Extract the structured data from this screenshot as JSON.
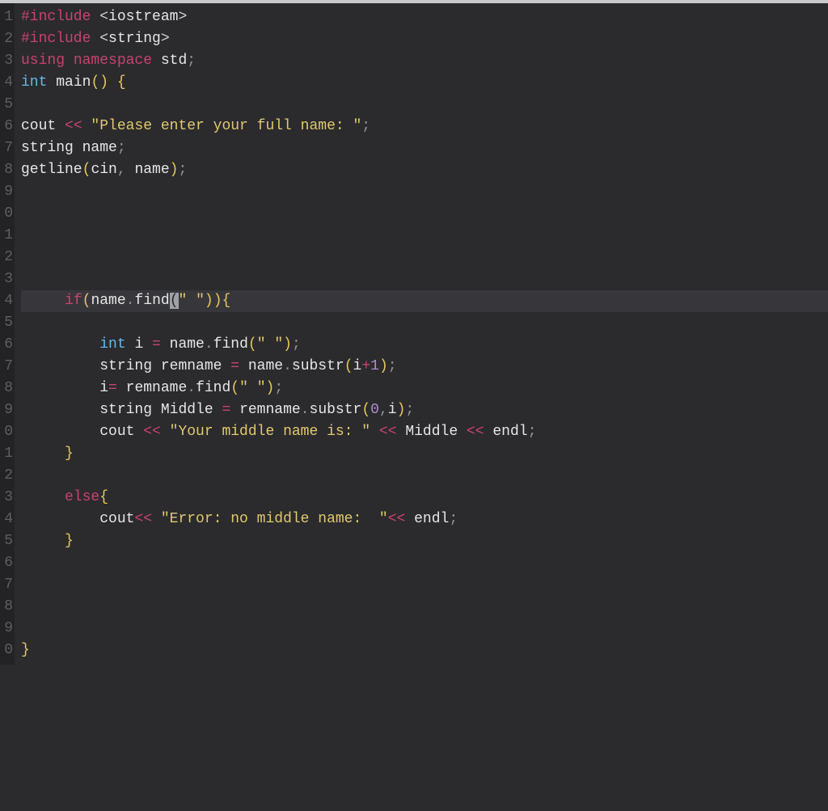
{
  "gutter": [
    "1",
    "2",
    "3",
    "4",
    "5",
    "6",
    "7",
    "8",
    "9",
    "0",
    "1",
    "2",
    "3",
    "4",
    "5",
    "6",
    "7",
    "8",
    "9",
    "0",
    "1",
    "2",
    "3",
    "4",
    "5",
    "6",
    "7",
    "8",
    "9",
    "0"
  ],
  "code": {
    "l1": {
      "pre": "#include ",
      "lt": "<",
      "lib": "iostream",
      "gt": ">"
    },
    "l2": {
      "pre": "#include ",
      "lt": "<",
      "lib": "string",
      "gt": ">"
    },
    "l3": {
      "using": "using ",
      "ns": "namespace ",
      "std": "std",
      "semi": ";"
    },
    "l4": {
      "type": "int ",
      "main": "main",
      "lp": "(",
      "rp": ")",
      " ": " ",
      "lb": "{"
    },
    "l6": {
      "cout": "cout ",
      "op1": "<< ",
      "str": "\"Please enter your full name: \"",
      "semi": ";"
    },
    "l7": {
      "type": "string ",
      "id": "name",
      "semi": ";"
    },
    "l8": {
      "fn": "getline",
      "lp": "(",
      "cin": "cin",
      "comma": ", ",
      "name": "name",
      "rp": ")",
      "semi": ";"
    },
    "l14": {
      "indent": "     ",
      "if": "if",
      "lp": "(",
      "name": "name",
      "dot": ".",
      "find": "find",
      "lp2": "(",
      "cursorstr": "\" \"",
      "rp2": ")",
      "rp": ")",
      "lb": "{"
    },
    "l16": {
      "indent": "         ",
      "type": "int ",
      "i": "i ",
      "eq": "= ",
      "name": "name",
      "dot": ".",
      "find": "find",
      "lp": "(",
      "str": "\" \"",
      "rp": ")",
      "semi": ";"
    },
    "l17": {
      "indent": "         ",
      "type": "string ",
      "rem": "remname ",
      "eq": "= ",
      "name": "name",
      "dot": ".",
      "sub": "substr",
      "lp": "(",
      "i": "i",
      "plus": "+",
      "one": "1",
      "rp": ")",
      "semi": ";"
    },
    "l18": {
      "indent": "         ",
      "i": "i",
      "eq": "= ",
      "rem": "remname",
      "dot": ".",
      "find": "find",
      "lp": "(",
      "str": "\" \"",
      "rp": ")",
      "semi": ";"
    },
    "l19": {
      "indent": "         ",
      "type": "string ",
      "mid": "Middle ",
      "eq": "= ",
      "rem": "remname",
      "dot": ".",
      "sub": "substr",
      "lp": "(",
      "zero": "0",
      "comma": ",",
      "i": "i",
      "rp": ")",
      "semi": ";"
    },
    "l20": {
      "indent": "         ",
      "cout": "cout ",
      "op1": "<< ",
      "str": "\"Your middle name is: \"",
      "op2": " << ",
      "mid": "Middle ",
      "op3": "<< ",
      "endl": "endl",
      "semi": ";"
    },
    "l21": {
      "indent": "     ",
      "rb": "}"
    },
    "l23": {
      "indent": "     ",
      "else": "else",
      "lb": "{"
    },
    "l24": {
      "indent": "         ",
      "cout": "cout",
      "op1": "<< ",
      "str": "\"Error: no middle name:  \"",
      "op2": "<< ",
      "endl": "endl",
      "semi": ";"
    },
    "l25": {
      "indent": "     ",
      "rb": "}"
    },
    "l30": {
      "rb": "}"
    }
  },
  "highlighted_line": 14
}
